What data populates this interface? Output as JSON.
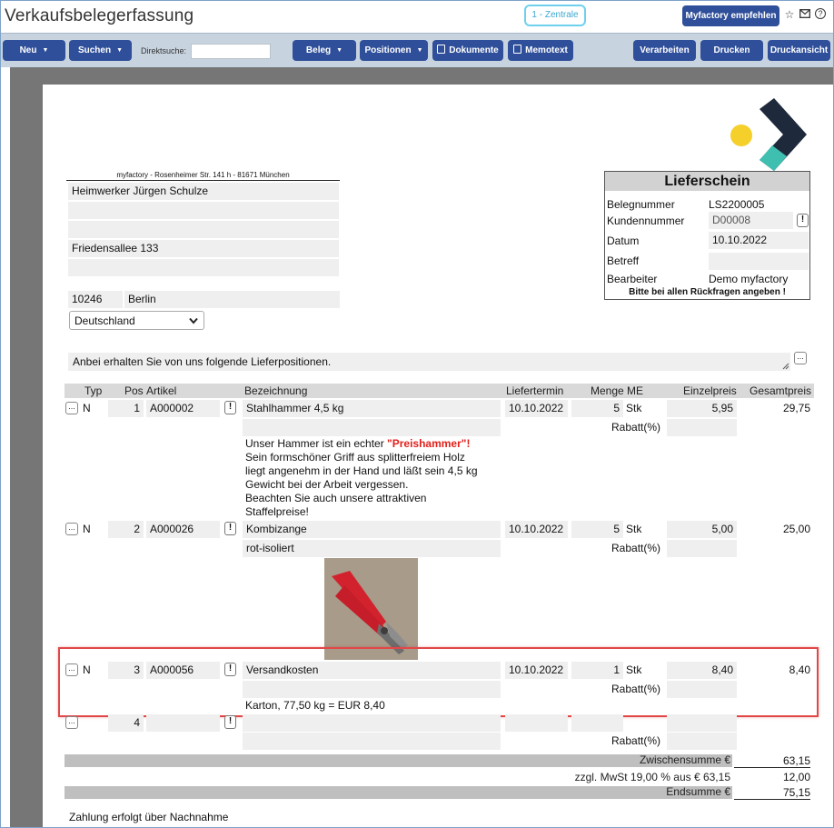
{
  "app": {
    "title": "Verkaufsbelegerfassung",
    "tenant": "1 - Zentrale",
    "recommend_label": "Myfactory empfehlen"
  },
  "toolbar": {
    "neu": "Neu",
    "suchen": "Suchen",
    "direktsuche_label": "Direktsuche:",
    "direktsuche_value": "",
    "beleg": "Beleg",
    "positionen": "Positionen",
    "dokumente": "Dokumente",
    "memotext": "Memotext",
    "verarbeiten": "Verarbeiten",
    "drucken": "Drucken",
    "druckansicht": "Druckansicht"
  },
  "address": {
    "sender_line": "myfactory - Rosenheimer Str. 141 h - 81671 München",
    "name": "Heimwerker Jürgen Schulze",
    "line2": "",
    "line3": "",
    "street": "Friedensallee 133",
    "line5": "",
    "zip": "10246",
    "city": "Berlin",
    "country": "Deutschland"
  },
  "doc_box": {
    "title": "Lieferschein",
    "belegnummer_label": "Belegnummer",
    "belegnummer": "LS2200005",
    "kundennummer_label": "Kundennummer",
    "kundennummer": "D00008",
    "datum_label": "Datum",
    "datum": "10.10.2022",
    "betreff_label": "Betreff",
    "betreff": "",
    "bearbeiter_label": "Bearbeiter",
    "bearbeiter": "Demo myfactory",
    "note": "Bitte bei allen Rückfragen angeben !"
  },
  "intro_text": "Anbei erhalten Sie von uns folgende Lieferpositionen.",
  "table": {
    "headers": {
      "typ": "Typ",
      "pos": "Pos",
      "artikel": "Artikel",
      "bezeichnung": "Bezeichnung",
      "liefertermin": "Liefertermin",
      "menge_me": "Menge ME",
      "einzelpreis": "Einzelpreis",
      "gesamtpreis": "Gesamtpreis"
    },
    "rabatt_label": "Rabatt(%)",
    "rows": [
      {
        "typ": "N",
        "pos": "1",
        "artikel": "A000002",
        "bezeichnung": "Stahlhammer 4,5 kg",
        "liefertermin": "10.10.2022",
        "menge": "5",
        "me": "Stk",
        "einzelpreis": "5,95",
        "gesamtpreis": "29,75",
        "zusatz": "",
        "memo": {
          "line1_pre": "Unser Hammer ist ein echter ",
          "line1_highlight": "\"Preishammer\"!",
          "line2": "Sein formschöner Griff aus splitterfreiem Holz",
          "line3": "liegt angenehm in der Hand und läßt sein 4,5 kg",
          "line4": "Gewicht bei der Arbeit vergessen.",
          "line5": "Beachten Sie auch unsere attraktiven",
          "line6": "Staffelpreise!"
        }
      },
      {
        "typ": "N",
        "pos": "2",
        "artikel": "A000026",
        "bezeichnung": "Kombizange",
        "liefertermin": "10.10.2022",
        "menge": "5",
        "me": "Stk",
        "einzelpreis": "5,00",
        "gesamtpreis": "25,00",
        "zusatz": "rot-isoliert"
      },
      {
        "typ": "N",
        "pos": "3",
        "artikel": "A000056",
        "bezeichnung": "Versandkosten",
        "liefertermin": "10.10.2022",
        "menge": "1",
        "me": "Stk",
        "einzelpreis": "8,40",
        "gesamtpreis": "8,40",
        "zusatz": "",
        "memo": "Karton, 77,50 kg = EUR 8,40"
      },
      {
        "typ": "",
        "pos": "4",
        "artikel": "",
        "bezeichnung": "",
        "liefertermin": "",
        "menge": "",
        "me": "",
        "einzelpreis": "",
        "gesamtpreis": "",
        "zusatz": ""
      }
    ]
  },
  "totals": {
    "zwischensumme_label": "Zwischensumme €",
    "zwischensumme": "63,15",
    "mwst_label": "zzgl. MwSt 19,00 % aus € 63,15",
    "mwst": "12,00",
    "endsumme_label": "Endsumme €",
    "endsumme": "75,15"
  },
  "footer_text": "Zahlung erfolgt über Nachnahme",
  "colors": {
    "primary_button": "#2f4f9a",
    "toolbar_bg": "#c7d3df",
    "tenant_border": "#6fd0ee",
    "highlight_border": "#e04848",
    "logo_dark": "#1e2a3c",
    "logo_teal": "#3fbfb0",
    "logo_yellow": "#f5cf2a"
  }
}
